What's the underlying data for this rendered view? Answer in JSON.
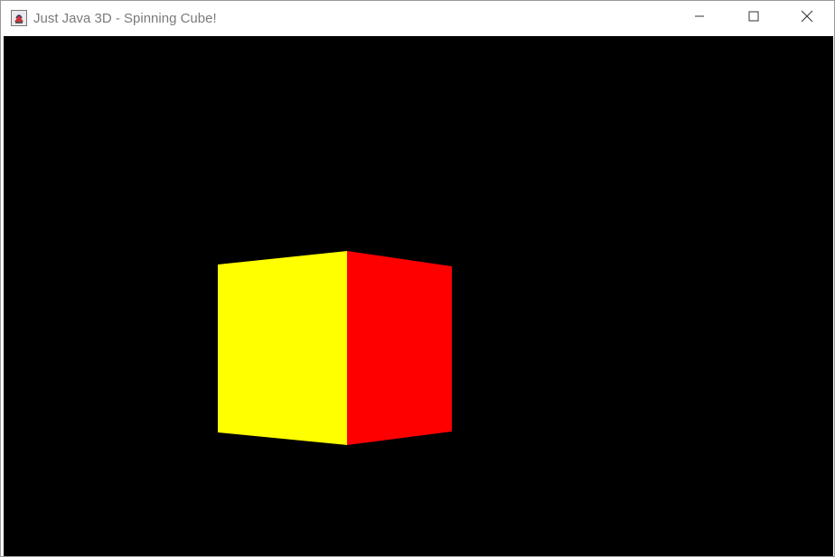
{
  "window": {
    "title": "Just Java 3D - Spinning Cube!",
    "icon": "java-cup-icon",
    "controls": [
      "minimize-icon",
      "maximize-icon",
      "close-icon"
    ]
  },
  "scene": {
    "background_color": "#000000",
    "cube": {
      "left_face_color": "#ffff00",
      "right_face_color": "#ff0000"
    }
  }
}
